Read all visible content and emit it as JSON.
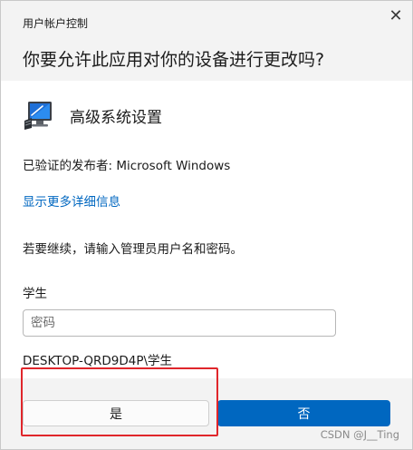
{
  "header": {
    "window_title": "用户帐户控制",
    "question": "你要允许此应用对你的设备进行更改吗?",
    "close_icon": "close-icon"
  },
  "app": {
    "icon": "computer-monitor-icon",
    "name": "高级系统设置"
  },
  "publisher": "已验证的发布者: Microsoft Windows",
  "details_link": "显示更多详细信息",
  "continue_text": "若要继续，请输入管理员用户名和密码。",
  "account": {
    "user_label": "学生",
    "password_placeholder": "密码",
    "domain_user": "DESKTOP-QRD9D4P\\学生"
  },
  "buttons": {
    "yes": "是",
    "no": "否"
  },
  "watermark": "CSDN @J__Ting",
  "colors": {
    "accent": "#0067c0",
    "header_bg": "#f3f3f3",
    "highlight": "#e0262b"
  }
}
